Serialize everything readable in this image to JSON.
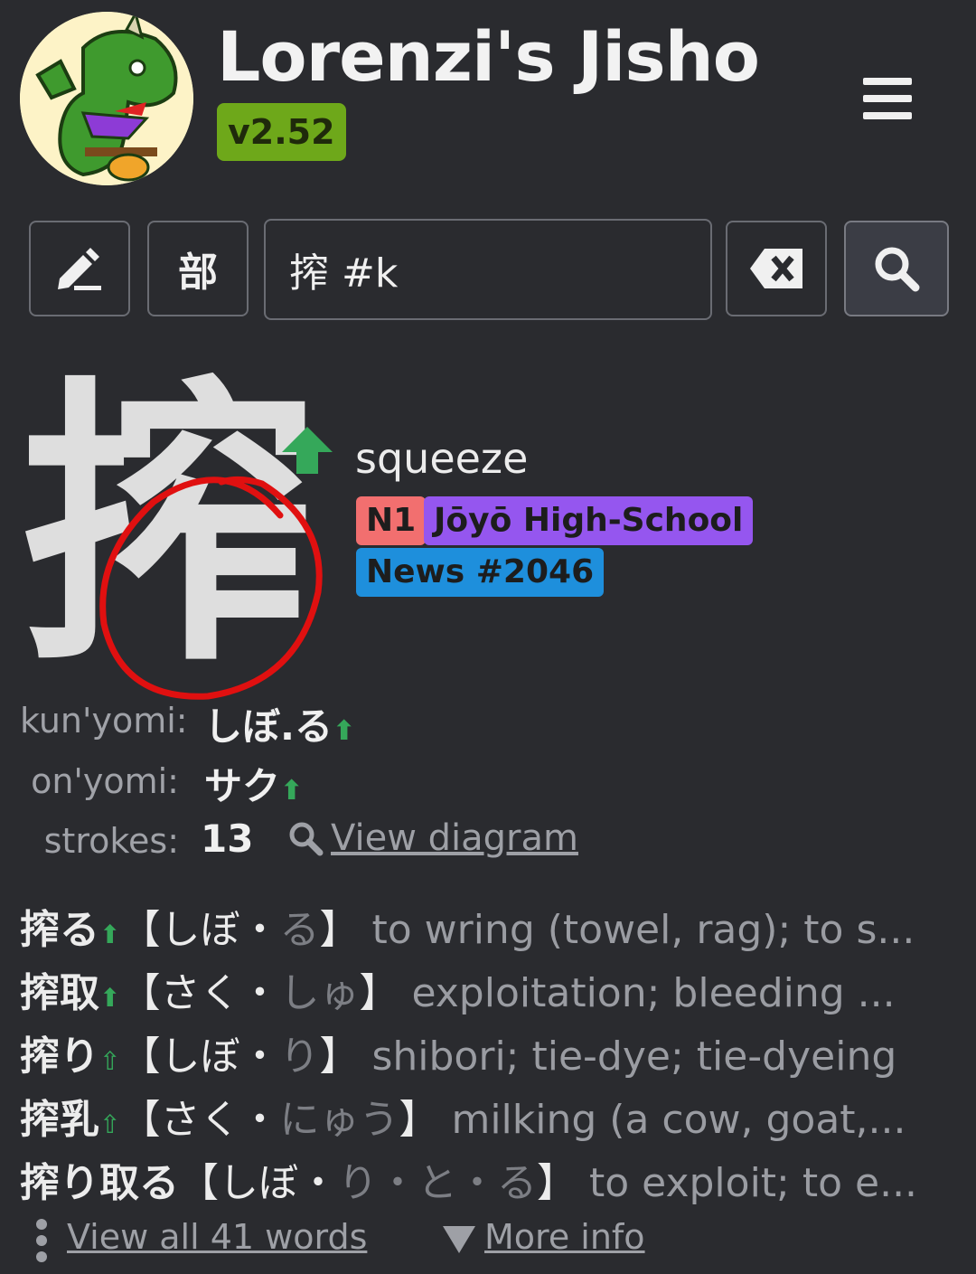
{
  "header": {
    "app_title": "Lorenzi's Jisho",
    "version": "v2.52",
    "menu_icon": "hamburger-menu-icon"
  },
  "toolbar": {
    "draw_icon": "handwriting-pencil-icon",
    "radical_label": "部",
    "search_value": "搾 #k",
    "clear_icon": "backspace-clear-icon",
    "search_icon": "magnifier-icon"
  },
  "kanji": {
    "character": "搾",
    "meaning": "squeeze",
    "tags": [
      "N1",
      "Jōyō High-School",
      "News #2046"
    ],
    "tag_colors": {
      "n1": "#f26f6f",
      "joyo": "#9556ef",
      "news": "#1e8fdc"
    }
  },
  "readings": {
    "kun_label": "kun'yomi:",
    "kun_value": "しぼ.る",
    "on_label": "on'yomi:",
    "on_value": "サク",
    "strokes_label": "strokes:",
    "strokes_value": "13",
    "diagram_link": "View diagram"
  },
  "vocab": [
    {
      "word": "搾る",
      "open": "【",
      "kana": "しぼ",
      "sep": "・",
      "okuri": "る",
      "close": "】",
      "def": "to wring (towel, rag); to s..."
    },
    {
      "word": "搾取",
      "open": "【",
      "kana": "さく",
      "sep": "・",
      "okuri": "しゅ",
      "close": "】",
      "def": "exploitation; bleeding ..."
    },
    {
      "word": "搾り",
      "open": "【",
      "kana": "しぼ",
      "sep": "・",
      "okuri": "り",
      "close": "】",
      "def": "shibori; tie-dye; tie-dyeing"
    },
    {
      "word": "搾乳",
      "open": "【",
      "kana": "さく",
      "sep": "・",
      "okuri": "にゅう",
      "close": "】",
      "def": "milking (a cow, goat,..."
    },
    {
      "word": "搾り取る",
      "open": "【",
      "kana": "しぼ",
      "sep": "・",
      "okuri": "り・と・る",
      "close": "】",
      "def": "to exploit; to e..."
    }
  ],
  "footer": {
    "view_all": "View all 41 words",
    "more_info": "More info"
  },
  "colors": {
    "background": "#2a2b2f",
    "accent_green": "#35a85a",
    "annotation_red": "#e01010"
  }
}
